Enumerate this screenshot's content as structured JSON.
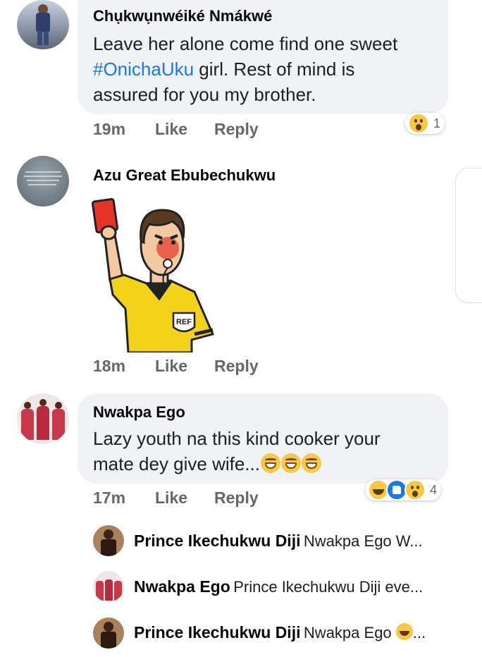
{
  "comments": [
    {
      "author": "Chụkwụnwéiké Nmákwé",
      "text_before": "Leave her alone come find one sweet",
      "hashtag": "#OnichaUku",
      "text_after": " girl. Rest of mind is",
      "text_line3": "assured for you my brother.",
      "time": "19m",
      "like": "Like",
      "reply": "Reply",
      "reaction_count": "1"
    },
    {
      "author": "Azu Great Ebubechukwu",
      "sticker": "referee-red-card-sticker",
      "sticker_badge": "REF",
      "time": "18m",
      "like": "Like",
      "reply": "Reply"
    },
    {
      "author": "Nwakpa Ego",
      "text_line1": "Lazy youth na this kind cooker your",
      "text_line2": "mate dey give wife...",
      "time": "17m",
      "like": "Like",
      "reply": "Reply",
      "reaction_count": "4"
    }
  ],
  "replies": [
    {
      "author": "Prince Ikechukwu Diji",
      "preview": "Nwakpa Ego W..."
    },
    {
      "author": "Nwakpa Ego",
      "preview": "Prince Ikechukwu Diji eve..."
    },
    {
      "author": "Prince Ikechukwu Diji",
      "preview": "Nwakpa Ego ",
      "preview_suffix": "..."
    }
  ],
  "colors": {
    "bubble": "#f0f2f5",
    "hashtag": "#1877f2",
    "meta": "#65676b",
    "referee_shirt": "#f2d21b",
    "red_card": "#e5332a"
  }
}
